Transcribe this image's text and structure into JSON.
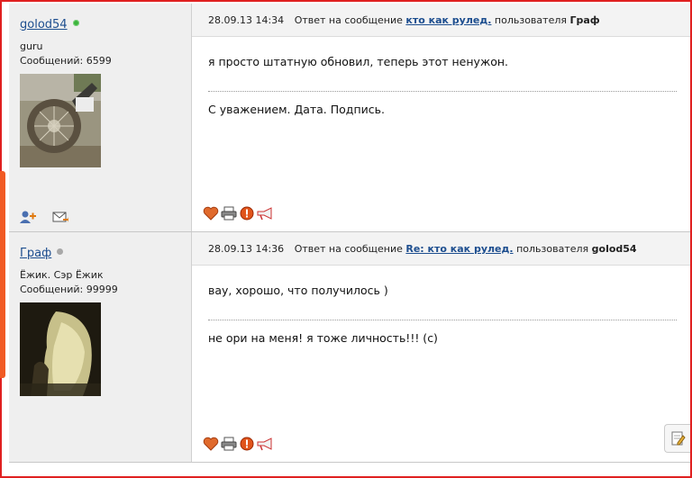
{
  "posts": [
    {
      "author": {
        "name": "golod54",
        "status": "online",
        "rank": "guru",
        "messages": "Сообщений: 6599"
      },
      "header": {
        "date": "28.09.13 14:34",
        "prefix": "Ответ на сообщение",
        "topic": "кто как рулед.",
        "mid": "пользователя",
        "user": "Граф"
      },
      "body": {
        "text": "я просто штатную обновил, теперь этот ненужон.",
        "signature": "С уважением. Дата. Подпись."
      }
    },
    {
      "author": {
        "name": "Граф",
        "status": "offline",
        "rank": "Ёжик. Сэр Ёжик",
        "messages": "Сообщений: 99999"
      },
      "header": {
        "date": "28.09.13 14:36",
        "prefix": "Ответ на сообщение",
        "topic": "Re: кто как рулед.",
        "mid": "пользователя",
        "user": "golod54"
      },
      "body": {
        "text": "вау, хорошо, что получилось )",
        "signature": "не ори на меня! я тоже личность!!! (с)"
      }
    }
  ],
  "icons": {
    "author_actions": [
      "add-friend-icon",
      "send-message-icon"
    ],
    "post_actions": [
      "heart-icon",
      "print-icon",
      "warning-icon",
      "megaphone-icon"
    ],
    "edit": "edit-icon"
  },
  "colors": {
    "link": "#1d4e8f",
    "online": "#3cb43c",
    "offline": "#a8a8a8",
    "frame": "#e02020"
  }
}
